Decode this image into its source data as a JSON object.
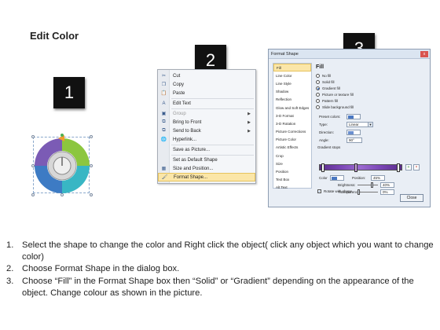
{
  "title": "Edit Color",
  "badges": [
    "1",
    "2",
    "3"
  ],
  "context_menu": {
    "items": [
      {
        "label": "Cut",
        "icon": "scissors-icon",
        "glyph": "✂"
      },
      {
        "label": "Copy",
        "icon": "copy-icon",
        "glyph": "❐"
      },
      {
        "label": "Paste",
        "icon": "paste-icon",
        "glyph": "📋"
      },
      {
        "label": "Edit Text",
        "icon": "edit-text-icon",
        "glyph": "A"
      },
      {
        "label": "Group",
        "icon": "group-icon",
        "glyph": "▣",
        "submenu": true,
        "disabled": true
      },
      {
        "label": "Bring to Front",
        "icon": "bring-to-front-icon",
        "glyph": "⧉",
        "submenu": true
      },
      {
        "label": "Send to Back",
        "icon": "send-to-back-icon",
        "glyph": "⧉",
        "submenu": true
      },
      {
        "label": "Hyperlink...",
        "icon": "hyperlink-icon",
        "glyph": "🌐"
      },
      {
        "label": "Save as Picture...",
        "icon": "",
        "glyph": ""
      },
      {
        "label": "Set as Default Shape",
        "icon": "",
        "glyph": ""
      },
      {
        "label": "Size and Position...",
        "icon": "size-position-icon",
        "glyph": "▦"
      },
      {
        "label": "Format Shape...",
        "icon": "format-shape-icon",
        "glyph": "🖌",
        "selected": true
      }
    ]
  },
  "format_shape_dialog": {
    "title": "Format Shape",
    "nav_items": [
      "Fill",
      "Line Color",
      "Line Style",
      "Shadow",
      "Reflection",
      "Glow and Soft Edges",
      "3-D Format",
      "3-D Rotation",
      "Picture Corrections",
      "Picture Color",
      "Artistic Effects",
      "Crop",
      "Size",
      "Position",
      "Text Box",
      "Alt Text"
    ],
    "active_nav": "Fill",
    "pane_heading": "Fill",
    "fill_options": [
      {
        "label": "No fill",
        "checked": false
      },
      {
        "label": "Solid fill",
        "checked": false
      },
      {
        "label": "Gradient fill",
        "checked": true
      },
      {
        "label": "Picture or texture fill",
        "checked": false
      },
      {
        "label": "Pattern fill",
        "checked": false
      },
      {
        "label": "Slide background fill",
        "checked": false
      }
    ],
    "preset_colors_label": "Preset colors:",
    "type_label": "Type:",
    "type_value": "Linear",
    "direction_label": "Direction:",
    "angle_label": "Angle:",
    "angle_value": "90°",
    "gradient_stops_label": "Gradient stops",
    "color_label": "Color",
    "position_label": "Position:",
    "position_value": "45%",
    "brightness_label": "Brightness:",
    "brightness_value": "40%",
    "transparency_label": "Transparency:",
    "transparency_value": "0%",
    "rotate_label": "Rotate with shape",
    "rotate_checked": true,
    "close_label": "Close",
    "close_x": "x"
  },
  "instructions": [
    {
      "num": "1.",
      "text": "Select the shape to change the color and Right click the object( click any object which you want to change color)"
    },
    {
      "num": "2.",
      "text": "Choose Format Shape in the dialog box."
    },
    {
      "num": "3.",
      "text": "Choose “Fill” in the Format Shape box then “Solid” or “Gradient” depending on the appearance of the object. Change colour as shown in the picture."
    }
  ],
  "colors": {
    "ring_purple": "#7b5bb5",
    "ring_green": "#8cc63f",
    "ring_teal": "#38b6c4",
    "ring_blue": "#3d7bc4",
    "ring_orange": "#f39c2f",
    "gradient_purple": "#7a45b5",
    "menu_highlight": "#fbe6a8"
  }
}
